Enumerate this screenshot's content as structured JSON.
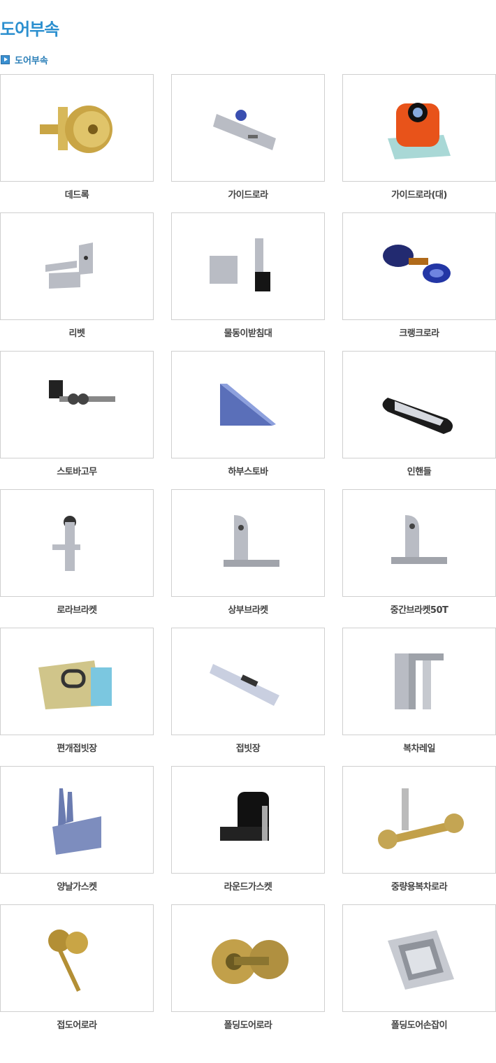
{
  "page": {
    "title": "도어부속"
  },
  "section": {
    "label": "도어부속",
    "icon": "play-square-icon"
  },
  "products": [
    {
      "name": "데드록",
      "icon": "deadlock-icon"
    },
    {
      "name": "가이드로라",
      "icon": "guide-roller-icon"
    },
    {
      "name": "가이드로라(대)",
      "icon": "guide-roller-large-icon"
    },
    {
      "name": "리벳",
      "icon": "rivet-bracket-icon"
    },
    {
      "name": "물동이받침대",
      "icon": "support-stand-icon"
    },
    {
      "name": "크랭크로라",
      "icon": "crank-roller-icon"
    },
    {
      "name": "스토바고무",
      "icon": "stopper-bolt-icon"
    },
    {
      "name": "하부스토바",
      "icon": "lower-stopper-icon"
    },
    {
      "name": "인핸들",
      "icon": "inner-handle-icon"
    },
    {
      "name": "로라브라켓",
      "icon": "roller-bracket-icon"
    },
    {
      "name": "상부브라켓",
      "icon": "upper-bracket-icon"
    },
    {
      "name": "중간브라켓50T",
      "icon": "middle-bracket-icon"
    },
    {
      "name": "편개접빗장",
      "icon": "hinge-latch-icon"
    },
    {
      "name": "접빗장",
      "icon": "flat-latch-icon"
    },
    {
      "name": "복차레일",
      "icon": "double-rail-icon"
    },
    {
      "name": "양날가스켓",
      "icon": "double-blade-gasket-icon"
    },
    {
      "name": "라운드가스켓",
      "icon": "round-gasket-icon"
    },
    {
      "name": "중량용복차로라",
      "icon": "heavy-double-roller-icon"
    },
    {
      "name": "접도어로라",
      "icon": "folding-door-roller-icon"
    },
    {
      "name": "폴딩도어로라",
      "icon": "folding-roller-wheel-icon"
    },
    {
      "name": "폴딩도어손잡이",
      "icon": "folding-door-handle-icon"
    }
  ]
}
